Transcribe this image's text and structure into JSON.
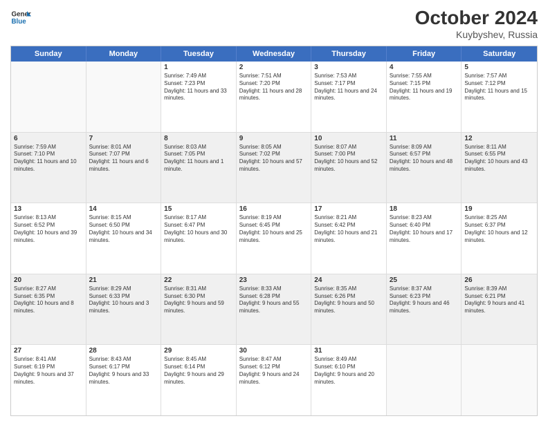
{
  "header": {
    "logo": {
      "line1": "General",
      "line2": "Blue"
    },
    "title": "October 2024",
    "location": "Kuybyshev, Russia"
  },
  "weekdays": [
    "Sunday",
    "Monday",
    "Tuesday",
    "Wednesday",
    "Thursday",
    "Friday",
    "Saturday"
  ],
  "rows": [
    [
      {
        "day": "",
        "sunrise": "",
        "sunset": "",
        "daylight": "",
        "empty": true
      },
      {
        "day": "",
        "sunrise": "",
        "sunset": "",
        "daylight": "",
        "empty": true
      },
      {
        "day": "1",
        "sunrise": "Sunrise: 7:49 AM",
        "sunset": "Sunset: 7:23 PM",
        "daylight": "Daylight: 11 hours and 33 minutes."
      },
      {
        "day": "2",
        "sunrise": "Sunrise: 7:51 AM",
        "sunset": "Sunset: 7:20 PM",
        "daylight": "Daylight: 11 hours and 28 minutes."
      },
      {
        "day": "3",
        "sunrise": "Sunrise: 7:53 AM",
        "sunset": "Sunset: 7:17 PM",
        "daylight": "Daylight: 11 hours and 24 minutes."
      },
      {
        "day": "4",
        "sunrise": "Sunrise: 7:55 AM",
        "sunset": "Sunset: 7:15 PM",
        "daylight": "Daylight: 11 hours and 19 minutes."
      },
      {
        "day": "5",
        "sunrise": "Sunrise: 7:57 AM",
        "sunset": "Sunset: 7:12 PM",
        "daylight": "Daylight: 11 hours and 15 minutes."
      }
    ],
    [
      {
        "day": "6",
        "sunrise": "Sunrise: 7:59 AM",
        "sunset": "Sunset: 7:10 PM",
        "daylight": "Daylight: 11 hours and 10 minutes."
      },
      {
        "day": "7",
        "sunrise": "Sunrise: 8:01 AM",
        "sunset": "Sunset: 7:07 PM",
        "daylight": "Daylight: 11 hours and 6 minutes."
      },
      {
        "day": "8",
        "sunrise": "Sunrise: 8:03 AM",
        "sunset": "Sunset: 7:05 PM",
        "daylight": "Daylight: 11 hours and 1 minute."
      },
      {
        "day": "9",
        "sunrise": "Sunrise: 8:05 AM",
        "sunset": "Sunset: 7:02 PM",
        "daylight": "Daylight: 10 hours and 57 minutes."
      },
      {
        "day": "10",
        "sunrise": "Sunrise: 8:07 AM",
        "sunset": "Sunset: 7:00 PM",
        "daylight": "Daylight: 10 hours and 52 minutes."
      },
      {
        "day": "11",
        "sunrise": "Sunrise: 8:09 AM",
        "sunset": "Sunset: 6:57 PM",
        "daylight": "Daylight: 10 hours and 48 minutes."
      },
      {
        "day": "12",
        "sunrise": "Sunrise: 8:11 AM",
        "sunset": "Sunset: 6:55 PM",
        "daylight": "Daylight: 10 hours and 43 minutes."
      }
    ],
    [
      {
        "day": "13",
        "sunrise": "Sunrise: 8:13 AM",
        "sunset": "Sunset: 6:52 PM",
        "daylight": "Daylight: 10 hours and 39 minutes."
      },
      {
        "day": "14",
        "sunrise": "Sunrise: 8:15 AM",
        "sunset": "Sunset: 6:50 PM",
        "daylight": "Daylight: 10 hours and 34 minutes."
      },
      {
        "day": "15",
        "sunrise": "Sunrise: 8:17 AM",
        "sunset": "Sunset: 6:47 PM",
        "daylight": "Daylight: 10 hours and 30 minutes."
      },
      {
        "day": "16",
        "sunrise": "Sunrise: 8:19 AM",
        "sunset": "Sunset: 6:45 PM",
        "daylight": "Daylight: 10 hours and 25 minutes."
      },
      {
        "day": "17",
        "sunrise": "Sunrise: 8:21 AM",
        "sunset": "Sunset: 6:42 PM",
        "daylight": "Daylight: 10 hours and 21 minutes."
      },
      {
        "day": "18",
        "sunrise": "Sunrise: 8:23 AM",
        "sunset": "Sunset: 6:40 PM",
        "daylight": "Daylight: 10 hours and 17 minutes."
      },
      {
        "day": "19",
        "sunrise": "Sunrise: 8:25 AM",
        "sunset": "Sunset: 6:37 PM",
        "daylight": "Daylight: 10 hours and 12 minutes."
      }
    ],
    [
      {
        "day": "20",
        "sunrise": "Sunrise: 8:27 AM",
        "sunset": "Sunset: 6:35 PM",
        "daylight": "Daylight: 10 hours and 8 minutes."
      },
      {
        "day": "21",
        "sunrise": "Sunrise: 8:29 AM",
        "sunset": "Sunset: 6:33 PM",
        "daylight": "Daylight: 10 hours and 3 minutes."
      },
      {
        "day": "22",
        "sunrise": "Sunrise: 8:31 AM",
        "sunset": "Sunset: 6:30 PM",
        "daylight": "Daylight: 9 hours and 59 minutes."
      },
      {
        "day": "23",
        "sunrise": "Sunrise: 8:33 AM",
        "sunset": "Sunset: 6:28 PM",
        "daylight": "Daylight: 9 hours and 55 minutes."
      },
      {
        "day": "24",
        "sunrise": "Sunrise: 8:35 AM",
        "sunset": "Sunset: 6:26 PM",
        "daylight": "Daylight: 9 hours and 50 minutes."
      },
      {
        "day": "25",
        "sunrise": "Sunrise: 8:37 AM",
        "sunset": "Sunset: 6:23 PM",
        "daylight": "Daylight: 9 hours and 46 minutes."
      },
      {
        "day": "26",
        "sunrise": "Sunrise: 8:39 AM",
        "sunset": "Sunset: 6:21 PM",
        "daylight": "Daylight: 9 hours and 41 minutes."
      }
    ],
    [
      {
        "day": "27",
        "sunrise": "Sunrise: 8:41 AM",
        "sunset": "Sunset: 6:19 PM",
        "daylight": "Daylight: 9 hours and 37 minutes."
      },
      {
        "day": "28",
        "sunrise": "Sunrise: 8:43 AM",
        "sunset": "Sunset: 6:17 PM",
        "daylight": "Daylight: 9 hours and 33 minutes."
      },
      {
        "day": "29",
        "sunrise": "Sunrise: 8:45 AM",
        "sunset": "Sunset: 6:14 PM",
        "daylight": "Daylight: 9 hours and 29 minutes."
      },
      {
        "day": "30",
        "sunrise": "Sunrise: 8:47 AM",
        "sunset": "Sunset: 6:12 PM",
        "daylight": "Daylight: 9 hours and 24 minutes."
      },
      {
        "day": "31",
        "sunrise": "Sunrise: 8:49 AM",
        "sunset": "Sunset: 6:10 PM",
        "daylight": "Daylight: 9 hours and 20 minutes."
      },
      {
        "day": "",
        "sunrise": "",
        "sunset": "",
        "daylight": "",
        "empty": true
      },
      {
        "day": "",
        "sunrise": "",
        "sunset": "",
        "daylight": "",
        "empty": true
      }
    ]
  ]
}
